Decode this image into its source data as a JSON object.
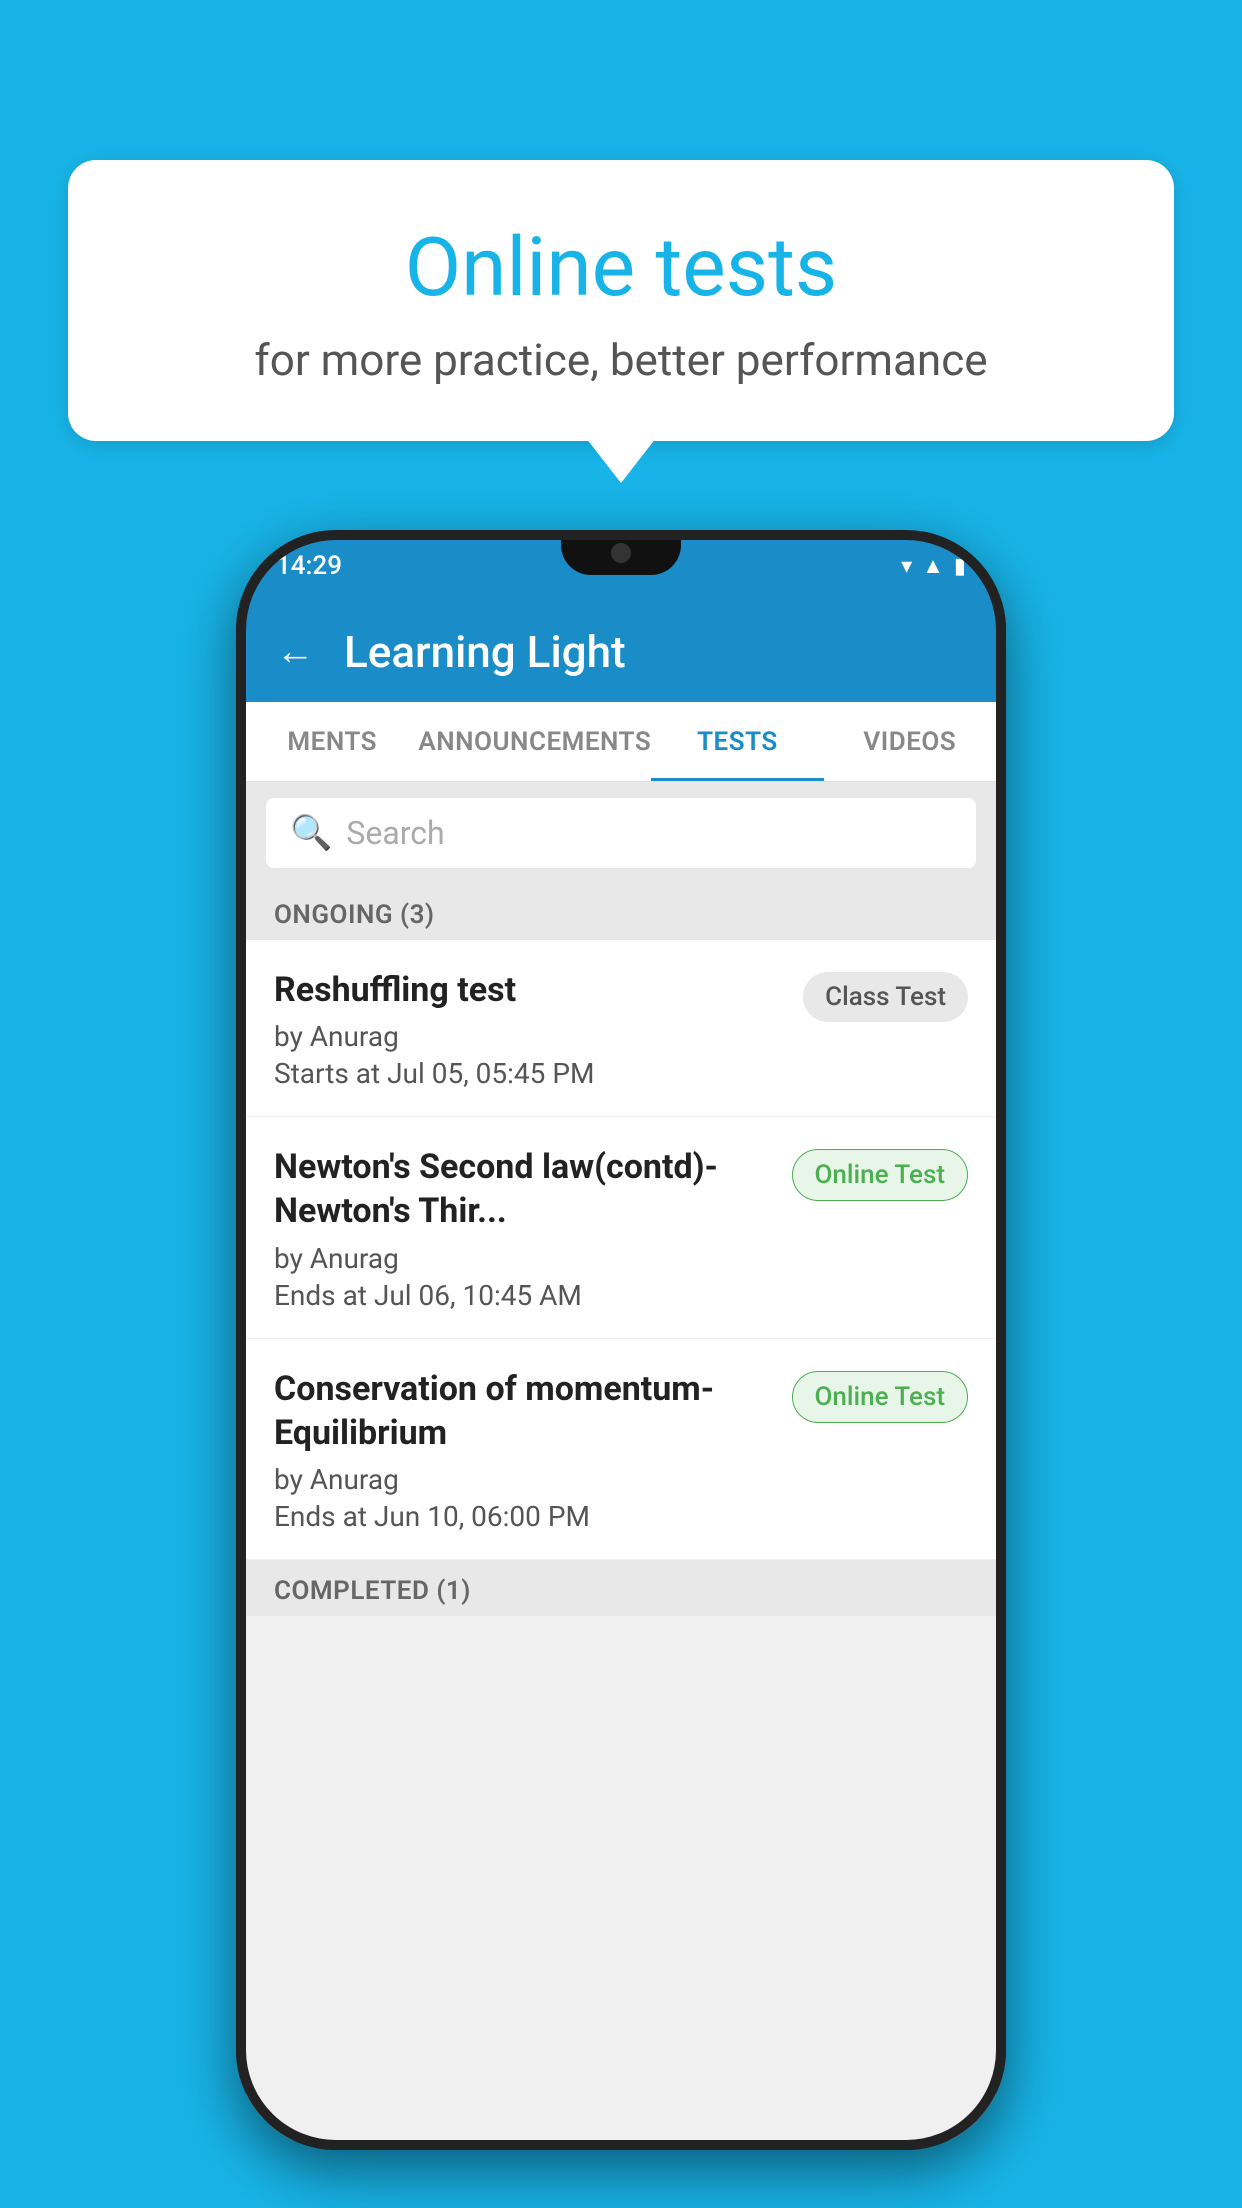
{
  "background": {
    "color": "#18b4e8"
  },
  "speech_bubble": {
    "title": "Online tests",
    "subtitle": "for more practice, better performance"
  },
  "phone": {
    "status_bar": {
      "time": "14:29",
      "icons": [
        "wifi",
        "signal",
        "battery"
      ]
    },
    "app_header": {
      "back_label": "←",
      "title": "Learning Light"
    },
    "tabs": [
      {
        "label": "MENTS",
        "active": false
      },
      {
        "label": "ANNOUNCEMENTS",
        "active": false
      },
      {
        "label": "TESTS",
        "active": true
      },
      {
        "label": "VIDEOS",
        "active": false
      }
    ],
    "search": {
      "placeholder": "Search"
    },
    "ongoing_section": {
      "label": "ONGOING (3)"
    },
    "tests": [
      {
        "name": "Reshuffling test",
        "author": "by Anurag",
        "date_label": "Starts at",
        "date": "Jul 05, 05:45 PM",
        "badge": "Class Test",
        "badge_type": "class"
      },
      {
        "name": "Newton's Second law(contd)-Newton's Thir...",
        "author": "by Anurag",
        "date_label": "Ends at",
        "date": "Jul 06, 10:45 AM",
        "badge": "Online Test",
        "badge_type": "online"
      },
      {
        "name": "Conservation of momentum-Equilibrium",
        "author": "by Anurag",
        "date_label": "Ends at",
        "date": "Jun 10, 06:00 PM",
        "badge": "Online Test",
        "badge_type": "online"
      }
    ],
    "completed_section": {
      "label": "COMPLETED (1)"
    }
  }
}
